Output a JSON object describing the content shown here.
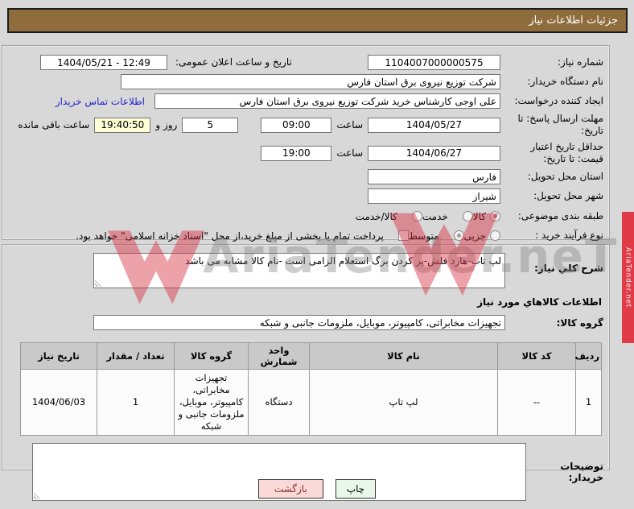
{
  "header": {
    "title": "جزئیات اطلاعات نیاز"
  },
  "form": {
    "need_number": {
      "label": "شماره نیاز:",
      "value": "1104007000000575"
    },
    "announce": {
      "label": "تاریخ و ساعت اعلان عمومی:",
      "value": "1404/05/21 - 12:49"
    },
    "buyer_org": {
      "label": "نام دستگاه خریدار:",
      "value": "شرکت توزیع نیروی برق استان فارس"
    },
    "creator": {
      "label": "ایجاد کننده درخواست:",
      "value": "علی اوجی کارشناس خرید شرکت توزیع نیروی برق استان فارس"
    },
    "buyer_contact_link": "اطلاعات تماس خریدار",
    "response_deadline": {
      "label": "مهلت ارسال پاسخ: تا تاریخ:",
      "date": "1404/05/27",
      "hour_label": "ساعت",
      "time": "09:00"
    },
    "remaining": {
      "days": "5",
      "days_label": "روز و",
      "time": "19:40:50",
      "suffix": "ساعت باقی مانده"
    },
    "price_validity": {
      "label": "حداقل تاریخ اعتبار قیمت: تا تاریخ:",
      "date": "1404/06/27",
      "hour_label": "ساعت",
      "time": "19:00"
    },
    "delivery_province": {
      "label": "استان محل تحویل:",
      "value": "فارس"
    },
    "delivery_city": {
      "label": "شهر محل تحویل:",
      "value": "شیراز"
    },
    "subject_class": {
      "label": "طبقه بندی موضوعی:",
      "options": [
        {
          "label": "کالا",
          "selected": true
        },
        {
          "label": "خدمت",
          "selected": false
        },
        {
          "label": "کالا/خدمت",
          "selected": false
        }
      ]
    },
    "process_type": {
      "label": "نوع فرآیند خرید :",
      "options": [
        {
          "label": "جزیی",
          "selected": false
        },
        {
          "label": "متوسط",
          "selected": true
        }
      ],
      "checkbox_label": "پرداخت تمام یا بخشی از مبلغ خرید،از محل \"اسناد خزانه اسلامی\" خواهد بود.",
      "checkbox_checked": false
    }
  },
  "description": {
    "label": "شرح کلي نیاز:",
    "value": "لپ تاب-هارد فلش-پر کردن برگ استعلام الزامی است -نام کالا مشابه می باشد"
  },
  "goods_section": {
    "title": "اطلاعات کالاهاي مورد نیاز",
    "group_label": "گروه کالا:",
    "group_value": "تجهیزات مخابراتی، کامپیوتر، موبایل، ملزومات جانبی و شبکه",
    "table": {
      "headers": [
        "ردیف",
        "کد کالا",
        "نام کالا",
        "واحد شمارش",
        "گروه کالا",
        "تعداد / مقدار",
        "تاریخ نیاز"
      ],
      "rows": [
        [
          "1",
          "--",
          "لپ تاپ",
          "دستگاه",
          "تجهیزات مخابراتی، کامپیوتر، موبایل، ملزومات جانبی و شبکه",
          "1",
          "1404/06/03"
        ]
      ]
    }
  },
  "buyer_notes": {
    "label": "توضیحات خریدار:",
    "value": ""
  },
  "buttons": {
    "print": "چاپ",
    "back": "بازگشت"
  },
  "watermark": {
    "big_text": "AriaTender.neT",
    "side_banner": "AriaTender.net"
  },
  "colors": {
    "titlebar": "#8e6c3c",
    "link": "#2323cb",
    "countdown_highlight": "#ffffd6",
    "button_print_bg": "#e9f7ea",
    "button_back_bg": "#fbd9d9",
    "watermark_red": "#e23340",
    "table_header_bg": "#c9c9c9",
    "page_bg": "#d8d8d8"
  }
}
